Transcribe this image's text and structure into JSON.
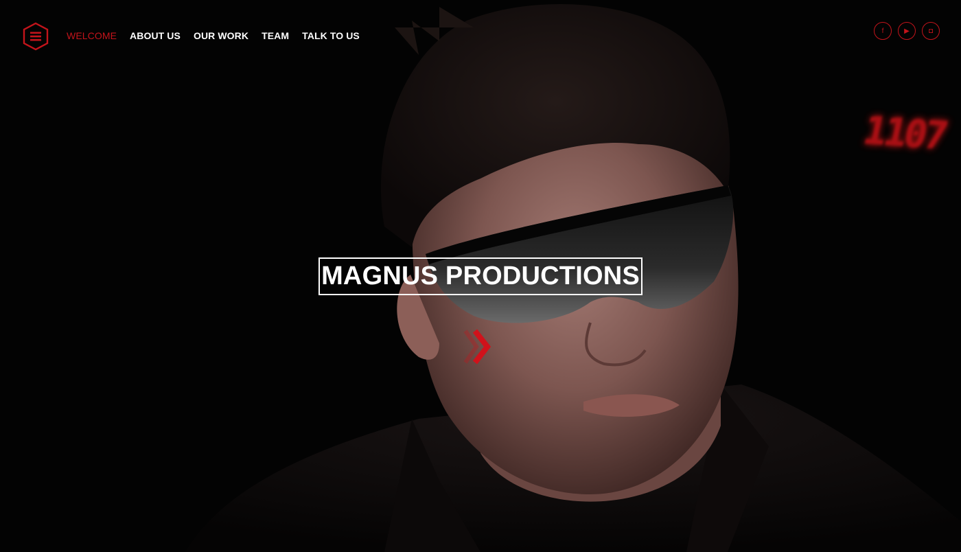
{
  "nav": {
    "items": [
      {
        "label": "WELCOME",
        "active": true
      },
      {
        "label": "ABOUT US",
        "active": false
      },
      {
        "label": "OUR WORK",
        "active": false
      },
      {
        "label": "TEAM",
        "active": false
      },
      {
        "label": "TALK TO US",
        "active": false
      }
    ]
  },
  "hero": {
    "title": "MAGNUS PRODUCTIONS",
    "background_clock": "1107"
  },
  "social": {
    "facebook": "f",
    "youtube": "▶",
    "instagram": "◘"
  },
  "colors": {
    "accent": "#c4141b",
    "text": "#ffffff",
    "background": "#020202"
  },
  "icons": {
    "menu": "hamburger-hexagon-icon",
    "next": "chevron-right-icon"
  }
}
